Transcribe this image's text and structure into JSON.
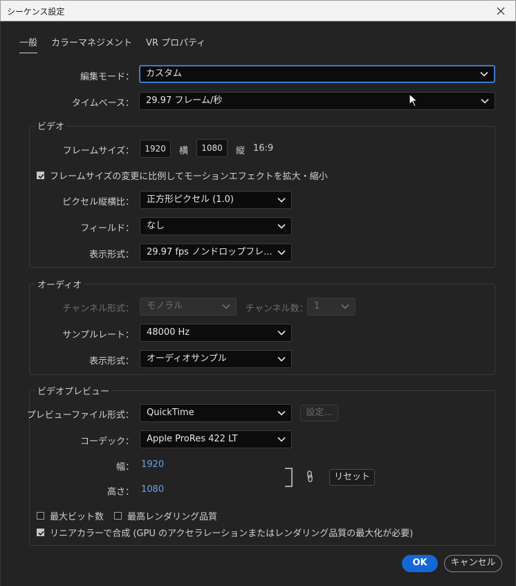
{
  "window": {
    "title": "シーケンス設定"
  },
  "tabs": [
    {
      "label": "一般",
      "active": true
    },
    {
      "label": "カラーマネジメント",
      "active": false
    },
    {
      "label": "VR プロパティ",
      "active": false
    }
  ],
  "general": {
    "edit_mode_label": "編集モード：",
    "edit_mode_value": "カスタム",
    "timebase_label": "タイムベース：",
    "timebase_value": "29.97  フレーム/秒"
  },
  "video": {
    "group_title": "ビデオ",
    "frame_size_label": "フレームサイズ：",
    "width": "1920",
    "width_unit": "横",
    "height": "1080",
    "height_unit": "縦",
    "aspect": "16:9",
    "scale_checkbox_label": "フレームサイズの変更に比例してモーションエフェクトを拡大・縮小",
    "scale_checked": true,
    "pixel_aspect_label": "ピクセル縦横比：",
    "pixel_aspect_value": "正方形ピクセル (1.0)",
    "fields_label": "フィールド：",
    "fields_value": "なし",
    "display_format_label": "表示形式：",
    "display_format_value": "29.97 fps ノンドロップフレ..."
  },
  "audio": {
    "group_title": "オーディオ",
    "channel_format_label": "チャンネル形式：",
    "channel_format_value": "モノラル",
    "channel_count_label": "チャンネル数：",
    "channel_count_value": "1",
    "sample_rate_label": "サンプルレート：",
    "sample_rate_value": "48000 Hz",
    "display_format_label": "表示形式：",
    "display_format_value": "オーディオサンプル"
  },
  "preview": {
    "group_title": "ビデオプレビュー",
    "file_format_label": "プレビューファイル形式：",
    "file_format_value": "QuickTime",
    "settings_button": "設定...",
    "codec_label": "コーデック：",
    "codec_value": "Apple ProRes 422 LT",
    "width_label": "幅：",
    "width_value": "1920",
    "height_label": "高さ：",
    "height_value": "1080",
    "reset_button": "リセット",
    "max_bit_depth_label": "最大ビット数",
    "max_bit_depth_checked": false,
    "max_render_quality_label": "最高レンダリング品質",
    "max_render_quality_checked": false,
    "linear_color_label": "リニアカラーで合成 (GPU のアクセラレーションまたはレンダリング品質の最大化が必要)",
    "linear_color_checked": true
  },
  "footer": {
    "ok_label": "OK",
    "cancel_label": "キャンセル"
  },
  "colors": {
    "accent": "#1468d6",
    "focus_border": "#3e7ccf",
    "link_value": "#6ea1e8"
  }
}
